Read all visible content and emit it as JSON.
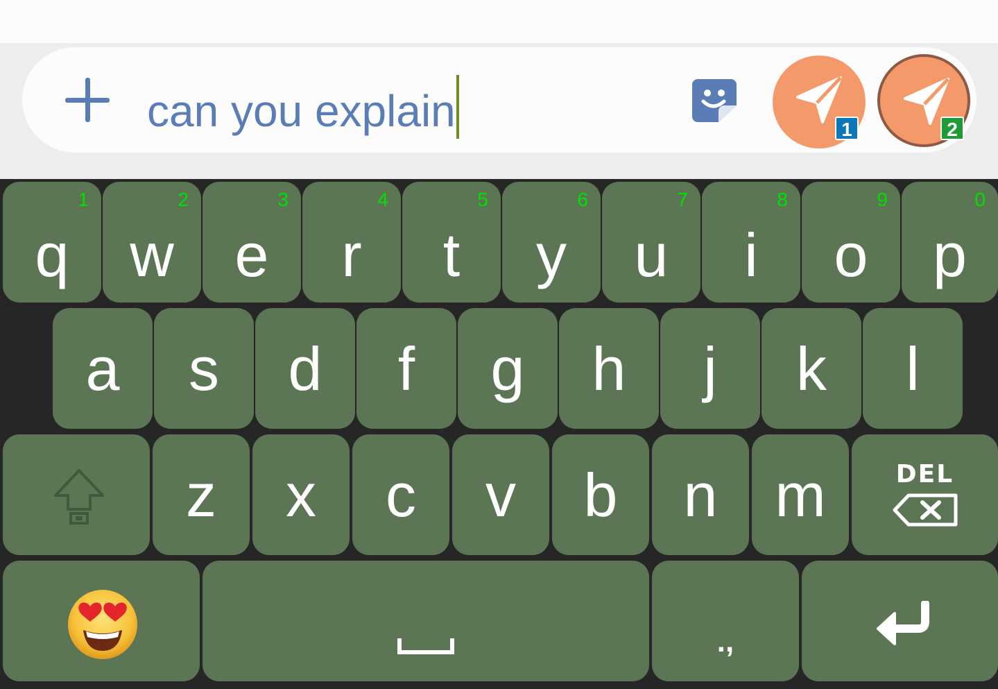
{
  "composer": {
    "attach_icon": "plus-icon",
    "message_text": "can you explain",
    "sticker_icon": "sticker-icon",
    "send_buttons": [
      {
        "icon": "send-icon",
        "badge": "1",
        "badge_color": "#0b76b8"
      },
      {
        "icon": "send-icon",
        "badge": "2",
        "badge_color": "#1e9b34"
      }
    ],
    "accent_color": "#5b7db6",
    "send_color": "#f49a6a"
  },
  "keyboard": {
    "key_color": "#5c7655",
    "number_hint_color": "#00e000",
    "row1": [
      {
        "label": "q",
        "hint": "1"
      },
      {
        "label": "w",
        "hint": "2"
      },
      {
        "label": "e",
        "hint": "3"
      },
      {
        "label": "r",
        "hint": "4"
      },
      {
        "label": "t",
        "hint": "5"
      },
      {
        "label": "y",
        "hint": "6"
      },
      {
        "label": "u",
        "hint": "7"
      },
      {
        "label": "i",
        "hint": "8"
      },
      {
        "label": "o",
        "hint": "9"
      },
      {
        "label": "p",
        "hint": "0"
      }
    ],
    "row2": [
      "a",
      "s",
      "d",
      "f",
      "g",
      "h",
      "j",
      "k",
      "l"
    ],
    "row3": [
      "z",
      "x",
      "c",
      "v",
      "b",
      "n",
      "m"
    ],
    "shift_icon": "shift-arrow-icon",
    "delete_label": "DEL",
    "delete_icon": "backspace-icon",
    "emoji_icon": "heart-eyes-emoji-icon",
    "space_icon": "spacebar-icon",
    "punctuation_label": ".,",
    "enter_icon": "enter-arrow-icon"
  }
}
